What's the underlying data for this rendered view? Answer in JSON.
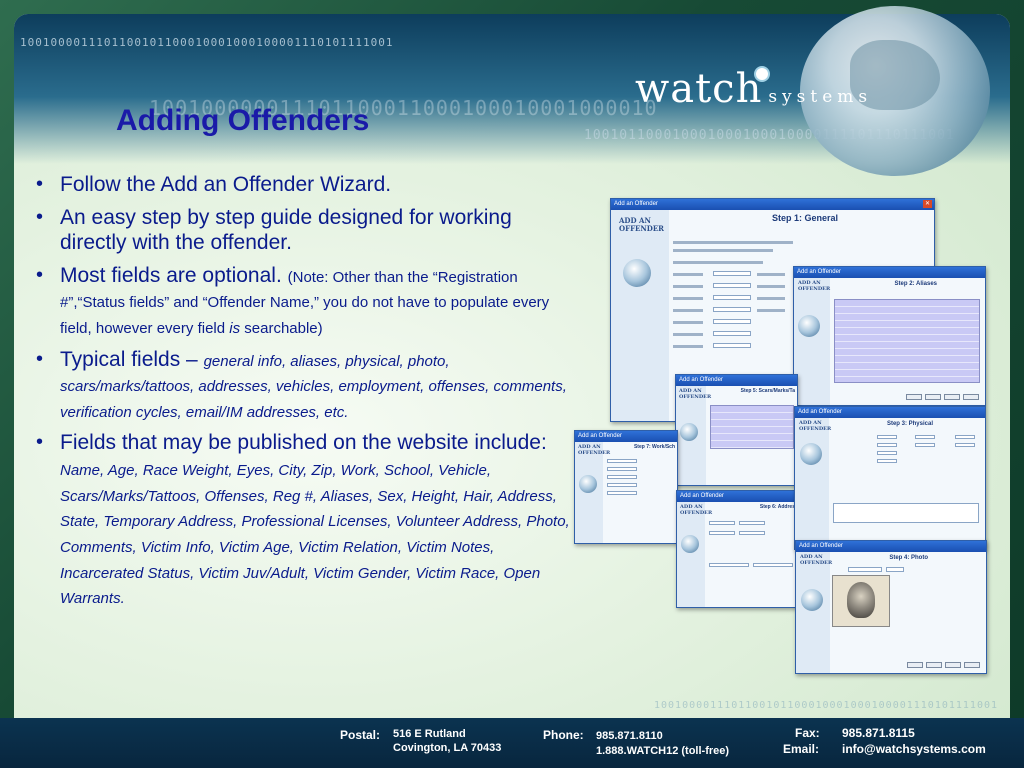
{
  "slide": {
    "title": "Adding Offenders",
    "binary_text_1": "1001000011101100101100010001000100001110101111001",
    "binary_text_2": "100100000011101100011000100010001000010",
    "binary_text_3": "100101100010001000100010000111101110111001",
    "binary_text_4": "1001000011101100101100010001000100001110101111001"
  },
  "logo": {
    "word": "watch",
    "sub": "systems"
  },
  "bullets": [
    {
      "text": "Follow the Add an Offender Wizard."
    },
    {
      "text": "An easy step by step guide designed for working directly with the offender."
    },
    {
      "lead": "Most fields are optional. ",
      "note_1": "(Note: Other than the “Registration #”,“Status fields” and “Offender Name,” you do not have to populate every field, however  every field ",
      "note_em": "is",
      "note_2": " searchable)"
    },
    {
      "lead": "Typical fields – ",
      "detail": "general info, aliases, physical, photo, scars/marks/tattoos, addresses, vehicles, employment, offenses, comments, verification cycles, email/IM addresses, etc."
    },
    {
      "lead": "Fields that may be published on the website include: ",
      "detail": "Name, Age, Race Weight, Eyes, City, Zip, Work, School, Vehicle, Scars/Marks/Tattoos, Offenses, Reg #, Aliases, Sex, Height, Hair, Address, State, Temporary Address, Professional Licenses, Volunteer Address, Photo, Comments, Victim Info, Victim Age, Victim Relation, Victim Notes, Incarcerated Status, Victim Juv/Adult, Victim Gender, Victim Race, Open Warrants."
    }
  ],
  "screens": {
    "window_title": "Add an Offender",
    "side_text": "ADD AN OFFENDER",
    "step1": "Step 1: General",
    "step2": "Step 2: Aliases",
    "step3": "Step 3: Physical",
    "step4": "Step 4: Photo",
    "step5": "Step 5: Scars/Marks/Ta",
    "step6": "Step 6: Addres",
    "step7": "Step 7: Work/Sch"
  },
  "footer": {
    "postal_label": "Postal:",
    "address_1": "516 E Rutland",
    "address_2": "Covington, LA 70433",
    "phone_label": "Phone:",
    "phone_1": "985.871.8110",
    "phone_2": "1.888.WATCH12 (toll-free)",
    "fax_label": "Fax:",
    "fax": "985.871.8115",
    "email_label": "Email:",
    "email": "info@watchsystems.com"
  }
}
